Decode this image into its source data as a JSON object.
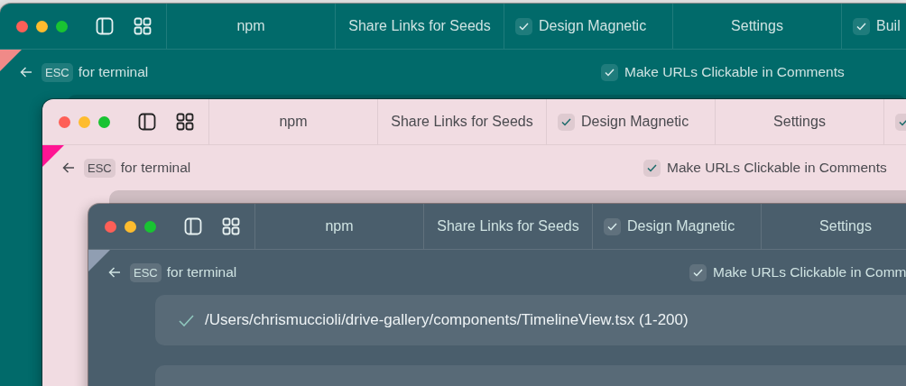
{
  "windows": [
    {
      "kind": "teal",
      "color": "#f08a88",
      "tabs": [
        {
          "kind": "plain",
          "label": "npm"
        },
        {
          "kind": "plain",
          "label": "Share Links for Seeds"
        },
        {
          "kind": "task",
          "checked": true,
          "label": "Design Magnetic"
        },
        {
          "kind": "plain",
          "label": "Settings"
        },
        {
          "kind": "task",
          "checked": true,
          "label": "Buil"
        }
      ],
      "back_label": "for terminal",
      "key": "ESC",
      "option": {
        "checked": true,
        "label": "Make URLs Clickable in Comments"
      },
      "cards": [
        {
          "kind": "placeholder"
        }
      ]
    },
    {
      "kind": "pink",
      "color": "#ff1493",
      "tabs": [
        {
          "kind": "plain",
          "label": "npm"
        },
        {
          "kind": "plain",
          "label": "Share Links for Seeds"
        },
        {
          "kind": "task",
          "checked": true,
          "label": "Design Magnetic"
        },
        {
          "kind": "plain",
          "label": "Settings"
        },
        {
          "kind": "task",
          "checked": true
        }
      ],
      "back_label": "for terminal",
      "key": "ESC",
      "option": {
        "checked": true,
        "label": "Make URLs Clickable in Comments"
      },
      "cards": [
        {
          "kind": "placeholder"
        }
      ]
    },
    {
      "kind": "slate",
      "color": "#909eb2",
      "tabs": [
        {
          "kind": "plain",
          "label": "npm"
        },
        {
          "kind": "plain",
          "label": "Share Links for Seeds"
        },
        {
          "kind": "task",
          "checked": true,
          "label": "Design Magnetic"
        },
        {
          "kind": "plain",
          "label": "Settings"
        }
      ],
      "back_label": "for terminal",
      "key": "ESC",
      "option": {
        "checked": true,
        "label": "Make URLs Clickable in Comm"
      },
      "cards": [
        {
          "kind": "file",
          "path": "/Users/chrismuccioli/drive-gallery/components/TimelineView.tsx (1-200)"
        },
        {
          "kind": "placeholder"
        }
      ]
    }
  ]
}
